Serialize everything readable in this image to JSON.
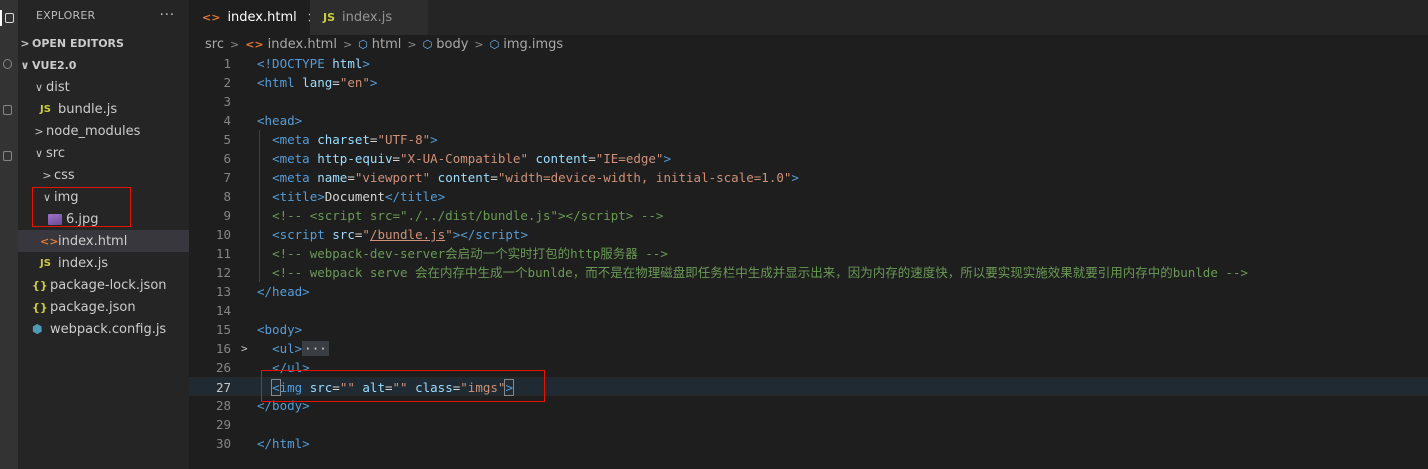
{
  "explorer": {
    "title": "EXPLORER",
    "more": "···",
    "open_editors": "OPEN EDITORS",
    "project": "VUE2.0",
    "tree": [
      {
        "label": "dist",
        "kind": "folder-open",
        "icon": "chevron-down-icon"
      },
      {
        "label": "bundle.js",
        "kind": "js",
        "badge": "JS"
      },
      {
        "label": "node_modules",
        "kind": "folder-closed",
        "icon": "chevron-right-icon"
      },
      {
        "label": "src",
        "kind": "folder-open",
        "icon": "chevron-down-icon"
      },
      {
        "label": "css",
        "kind": "folder-closed",
        "icon": "chevron-right-icon"
      },
      {
        "label": "img",
        "kind": "folder-open",
        "icon": "chevron-down-icon"
      },
      {
        "label": "6.jpg",
        "kind": "image",
        "icon": "image-file-icon"
      },
      {
        "label": "index.html",
        "kind": "html",
        "badge": "<>",
        "selected": true
      },
      {
        "label": "index.js",
        "kind": "js",
        "badge": "JS"
      },
      {
        "label": "package-lock.json",
        "kind": "json",
        "badge": "{}"
      },
      {
        "label": "package.json",
        "kind": "json",
        "badge": "{}"
      },
      {
        "label": "webpack.config.js",
        "kind": "config",
        "icon": "webpack-icon"
      }
    ]
  },
  "tabs": [
    {
      "label": "index.html",
      "badge": "<>",
      "active": true,
      "close": "×"
    },
    {
      "label": "index.js",
      "badge": "JS",
      "active": false
    }
  ],
  "breadcrumb": {
    "items": [
      "src",
      "index.html",
      "html",
      "body",
      "img.imgs"
    ],
    "separator": ">"
  },
  "editor": {
    "current_line": 27,
    "lines": [
      {
        "n": "1",
        "html": "<span class=\"c-tag\">&lt;!DOCTYPE</span> <span class=\"c-attr\">html</span><span class=\"c-tag\">&gt;</span>"
      },
      {
        "n": "2",
        "html": "<span class=\"c-tag\">&lt;html</span> <span class=\"c-attr\">lang</span><span class=\"c-txt\">=</span><span class=\"c-str\">\"en\"</span><span class=\"c-tag\">&gt;</span>"
      },
      {
        "n": "3",
        "html": ""
      },
      {
        "n": "4",
        "html": "<span class=\"c-tag\">&lt;head&gt;</span>"
      },
      {
        "n": "5",
        "html": "  <span class=\"c-tag\">&lt;meta</span> <span class=\"c-attr\">charset</span><span class=\"c-txt\">=</span><span class=\"c-str\">\"UTF-8\"</span><span class=\"c-tag\">&gt;</span>"
      },
      {
        "n": "6",
        "html": "  <span class=\"c-tag\">&lt;meta</span> <span class=\"c-attr\">http-equiv</span><span class=\"c-txt\">=</span><span class=\"c-str\">\"X-UA-Compatible\"</span> <span class=\"c-attr\">content</span><span class=\"c-txt\">=</span><span class=\"c-str\">\"IE=edge\"</span><span class=\"c-tag\">&gt;</span>"
      },
      {
        "n": "7",
        "html": "  <span class=\"c-tag\">&lt;meta</span> <span class=\"c-attr\">name</span><span class=\"c-txt\">=</span><span class=\"c-str\">\"viewport\"</span> <span class=\"c-attr\">content</span><span class=\"c-txt\">=</span><span class=\"c-str\">\"width=device-width, initial-scale=1.0\"</span><span class=\"c-tag\">&gt;</span>"
      },
      {
        "n": "8",
        "html": "  <span class=\"c-tag\">&lt;title&gt;</span><span class=\"c-txt\">Document</span><span class=\"c-tag\">&lt;/title&gt;</span>"
      },
      {
        "n": "9",
        "html": "  <span class=\"c-com\">&lt;!-- &lt;script src=\"./../dist/bundle.js\"&gt;&lt;/script&gt; --&gt;</span>"
      },
      {
        "n": "10",
        "html": "  <span class=\"c-tag\">&lt;script</span> <span class=\"c-attr\">src</span><span class=\"c-txt\">=</span><span class=\"c-str\">\"<span class=\"c-link\">/bundle.js</span>\"</span><span class=\"c-tag\">&gt;&lt;/script&gt;</span>"
      },
      {
        "n": "11",
        "html": "  <span class=\"c-com\">&lt;!-- webpack-dev-server会启动一个实时打包的http服务器 --&gt;</span>"
      },
      {
        "n": "12",
        "html": "  <span class=\"c-com\">&lt;!-- webpack serve 会在内存中生成一个bunlde，而不是在物理磁盘即任务栏中生成并显示出来，因为内存的速度快，所以要实现实施效果就要引用内存中的bunlde --&gt;</span>"
      },
      {
        "n": "13",
        "html": "<span class=\"c-tag\">&lt;/head&gt;</span>"
      },
      {
        "n": "14",
        "html": ""
      },
      {
        "n": "15",
        "html": "<span class=\"c-tag\">&lt;body&gt;</span>"
      },
      {
        "n": "16",
        "html": "  <span class=\"c-tag\">&lt;ul&gt;</span><span class=\"c-ell\">···</span>",
        "fold": ">"
      },
      {
        "n": "26",
        "html": "  <span class=\"c-tag\">&lt;/ul&gt;</span>"
      },
      {
        "n": "27",
        "html": "  <span class=\"c-tag bracket-hl\">&lt;</span><span class=\"c-tag\">img</span> <span class=\"c-attr\">src</span><span class=\"c-txt\">=</span><span class=\"c-str\">\"\"</span> <span class=\"c-attr\">alt</span><span class=\"c-txt\">=</span><span class=\"c-str\">\"\"</span> <span class=\"c-attr\">class</span><span class=\"c-txt\">=</span><span class=\"c-str\">\"imgs\"</span><span class=\"c-tag bracket-hl\">&gt;</span>"
      },
      {
        "n": "28",
        "html": "<span class=\"c-tag\">&lt;/body&gt;</span>"
      },
      {
        "n": "29",
        "html": ""
      },
      {
        "n": "30",
        "html": "<span class=\"c-tag\">&lt;/html&gt;</span>"
      }
    ]
  },
  "colors": {
    "annotation_box": "#e51400",
    "selected_row": "#37373d",
    "editor_bg": "#1e1e1e"
  }
}
